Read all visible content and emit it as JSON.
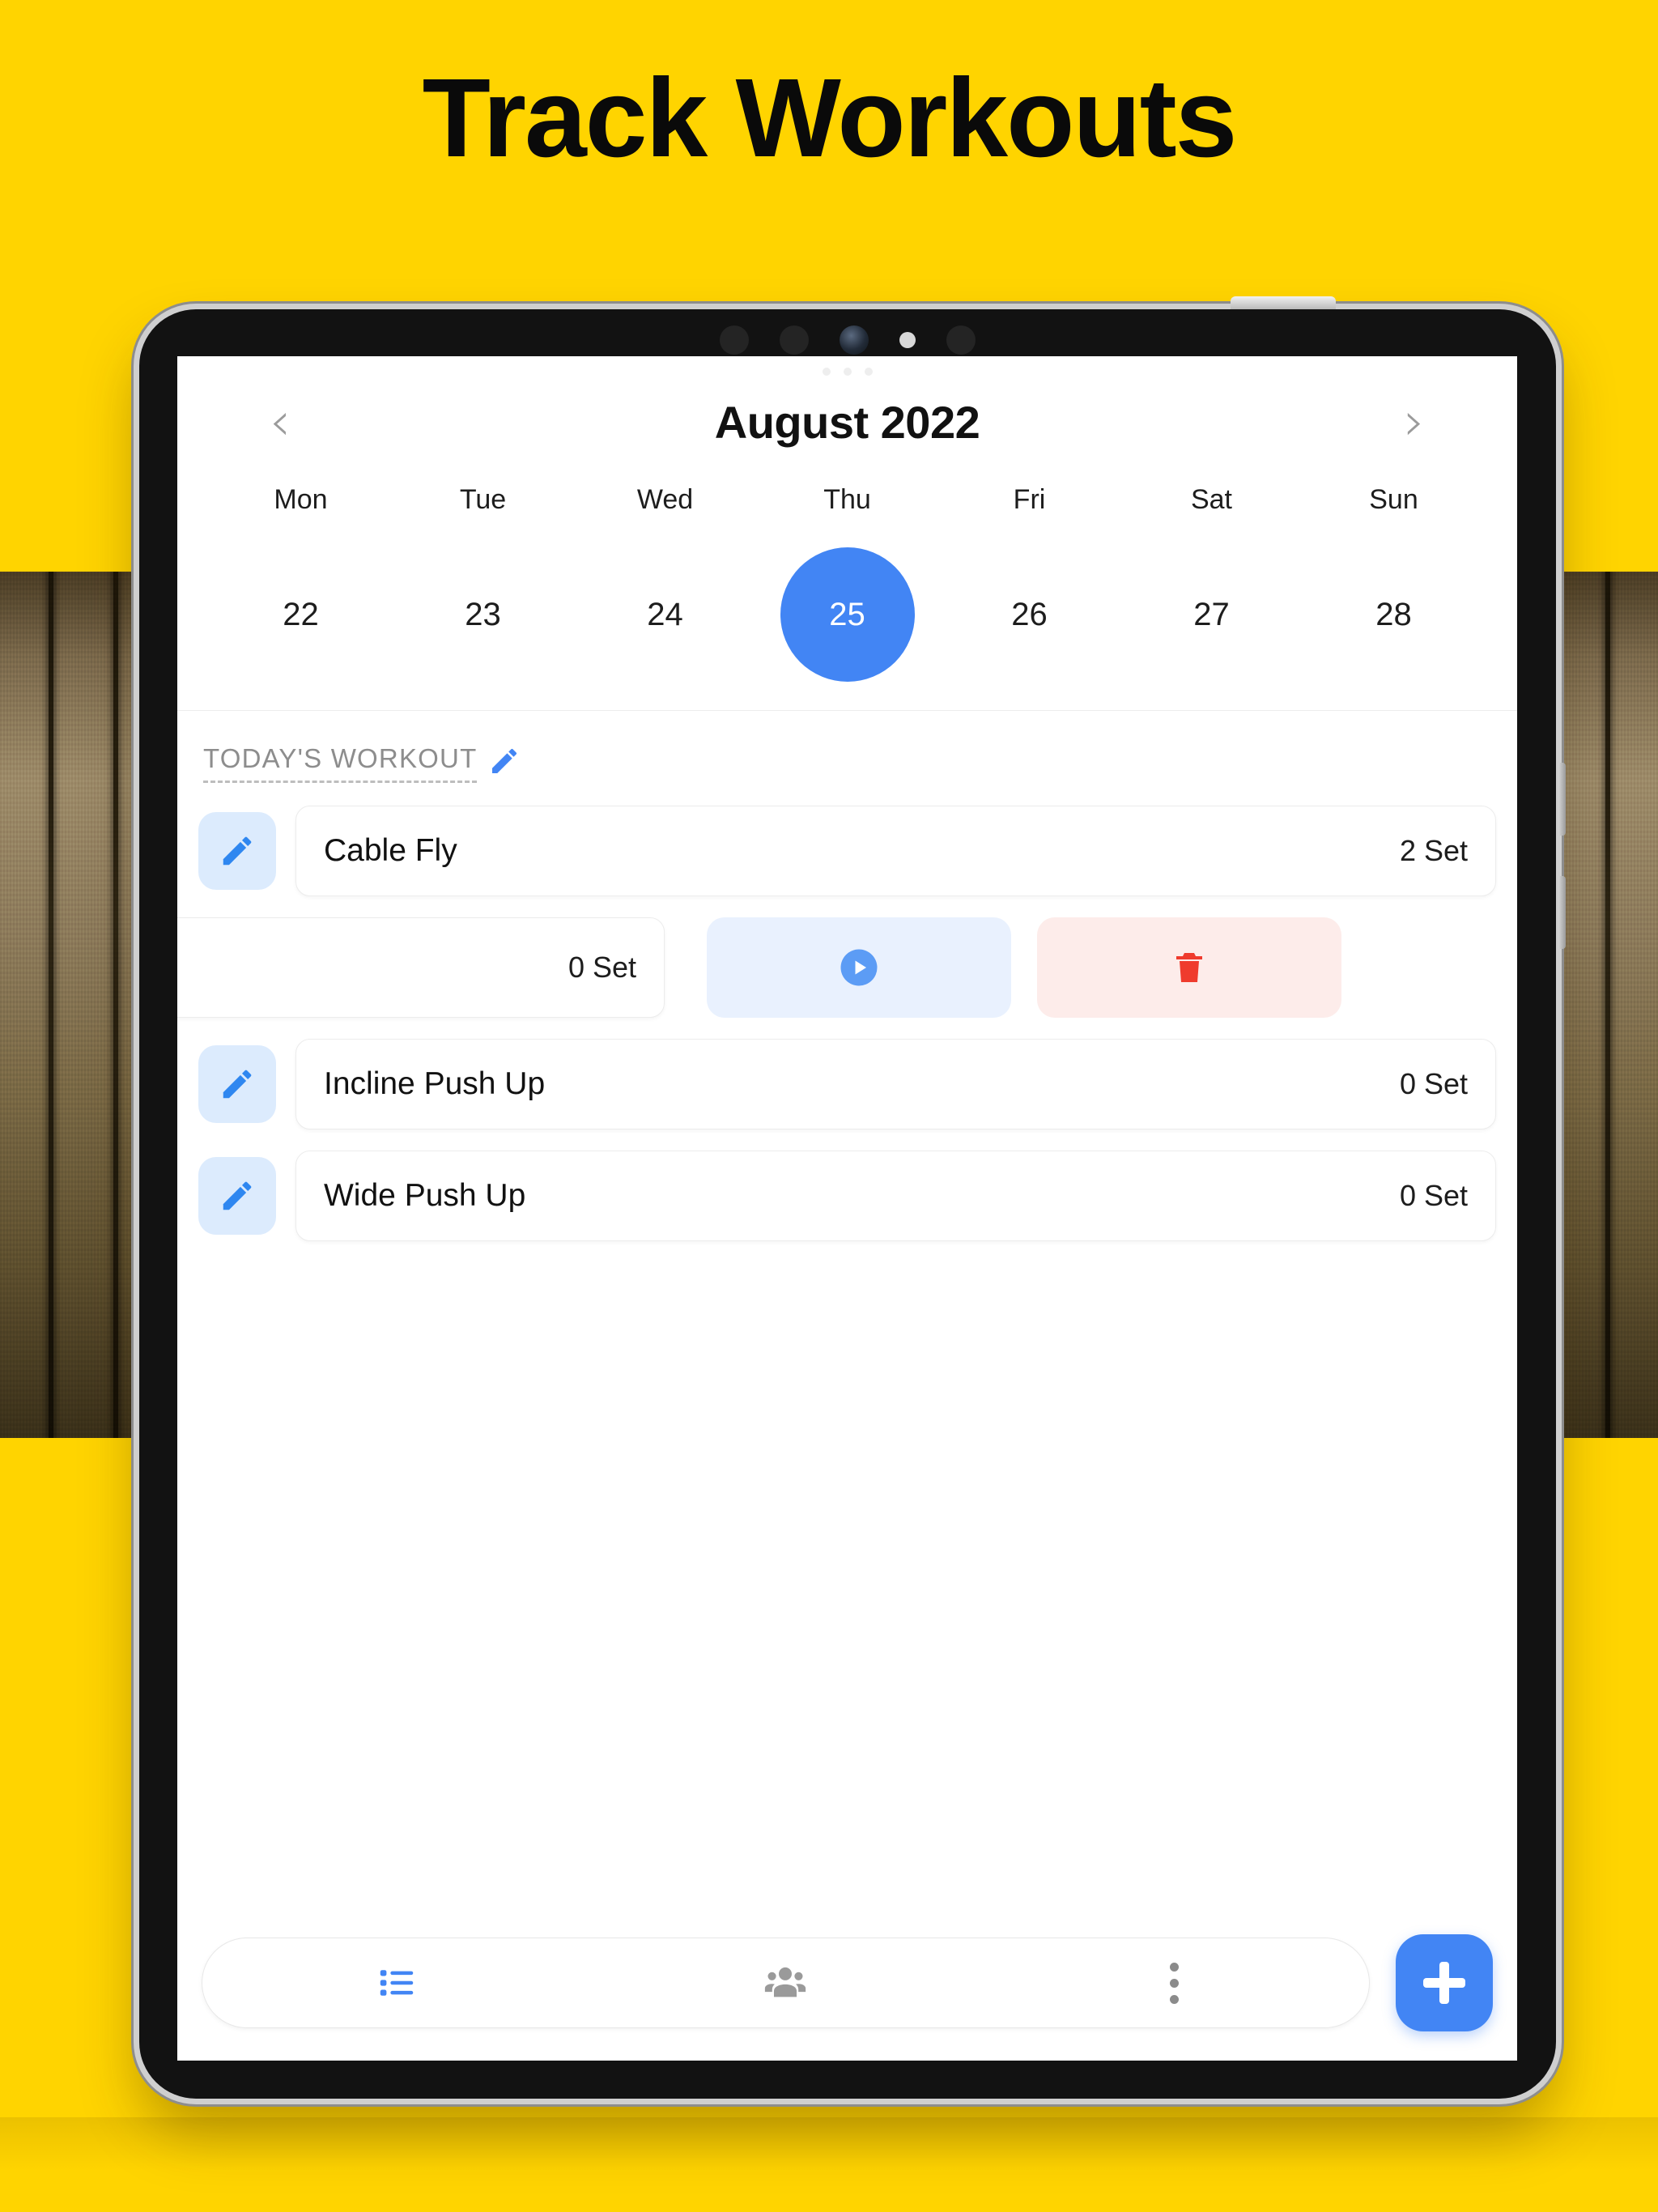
{
  "headline": "Track Workouts",
  "colors": {
    "background": "#FFD400",
    "accent_blue": "#4285F4",
    "accent_blue_soft": "#DCEBFD",
    "danger_red": "#EF3B2D",
    "danger_red_soft": "#FDECEA",
    "text_dark": "#111111",
    "text_muted": "#8D8D8D"
  },
  "calendar": {
    "prev_label": "‹",
    "next_label": "›",
    "title": "August 2022",
    "weekdays": [
      "Mon",
      "Tue",
      "Wed",
      "Thu",
      "Fri",
      "Sat",
      "Sun"
    ],
    "days": [
      {
        "num": "22",
        "selected": false
      },
      {
        "num": "23",
        "selected": false
      },
      {
        "num": "24",
        "selected": false
      },
      {
        "num": "25",
        "selected": true
      },
      {
        "num": "26",
        "selected": false
      },
      {
        "num": "27",
        "selected": false
      },
      {
        "num": "28",
        "selected": false
      }
    ]
  },
  "section": {
    "title": "TODAY'S WORKOUT",
    "edit_icon": "pencil-icon"
  },
  "exercises": [
    {
      "name": "Cable Fly",
      "sets": "2 Set",
      "edit_icon": "pencil-icon"
    },
    {
      "name": "Incline Push Up",
      "sets": "0 Set",
      "edit_icon": "pencil-icon"
    },
    {
      "name": "Wide Push Up",
      "sets": "0 Set",
      "edit_icon": "pencil-icon"
    }
  ],
  "swiped_row": {
    "sets": "0 Set",
    "play_icon": "play-circle-icon",
    "delete_icon": "trash-icon"
  },
  "bottom_nav": {
    "items": [
      {
        "icon": "list-icon",
        "active": true
      },
      {
        "icon": "people-icon",
        "active": false
      },
      {
        "icon": "more-vertical-icon",
        "active": false
      }
    ],
    "fab_icon": "plus-icon"
  }
}
